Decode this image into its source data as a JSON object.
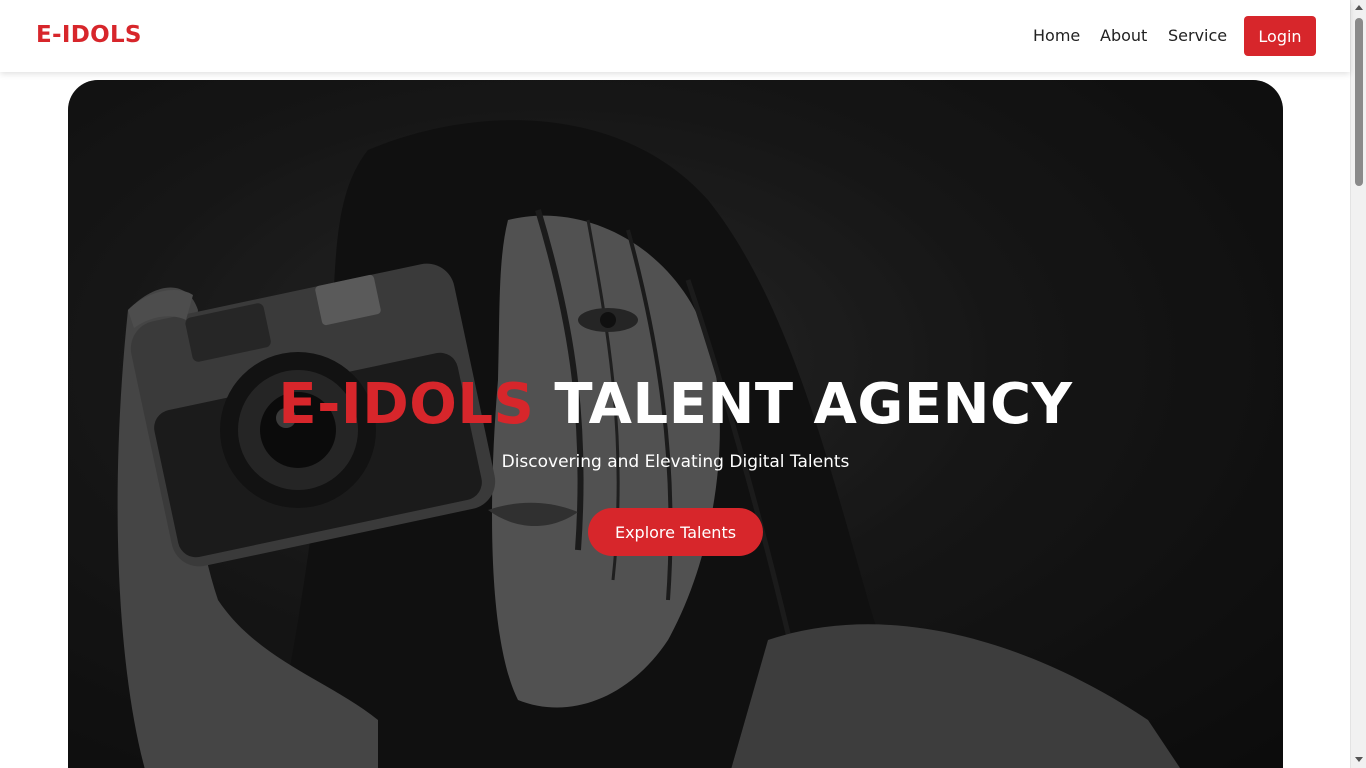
{
  "brand": {
    "name": "E-IDOLS"
  },
  "nav": {
    "links": [
      {
        "label": "Home"
      },
      {
        "label": "About"
      },
      {
        "label": "Service"
      }
    ],
    "login_label": "Login"
  },
  "hero": {
    "title_accent": "E-IDOLS",
    "title_rest": "TALENT AGENCY",
    "subtitle": "Discovering and Elevating Digital Talents",
    "cta_label": "Explore Talents"
  },
  "colors": {
    "accent": "#d7262b",
    "hero_text": "#ffffff",
    "nav_text": "#222222"
  },
  "icons": {
    "hero_image": "woman-holding-camera-photo"
  }
}
